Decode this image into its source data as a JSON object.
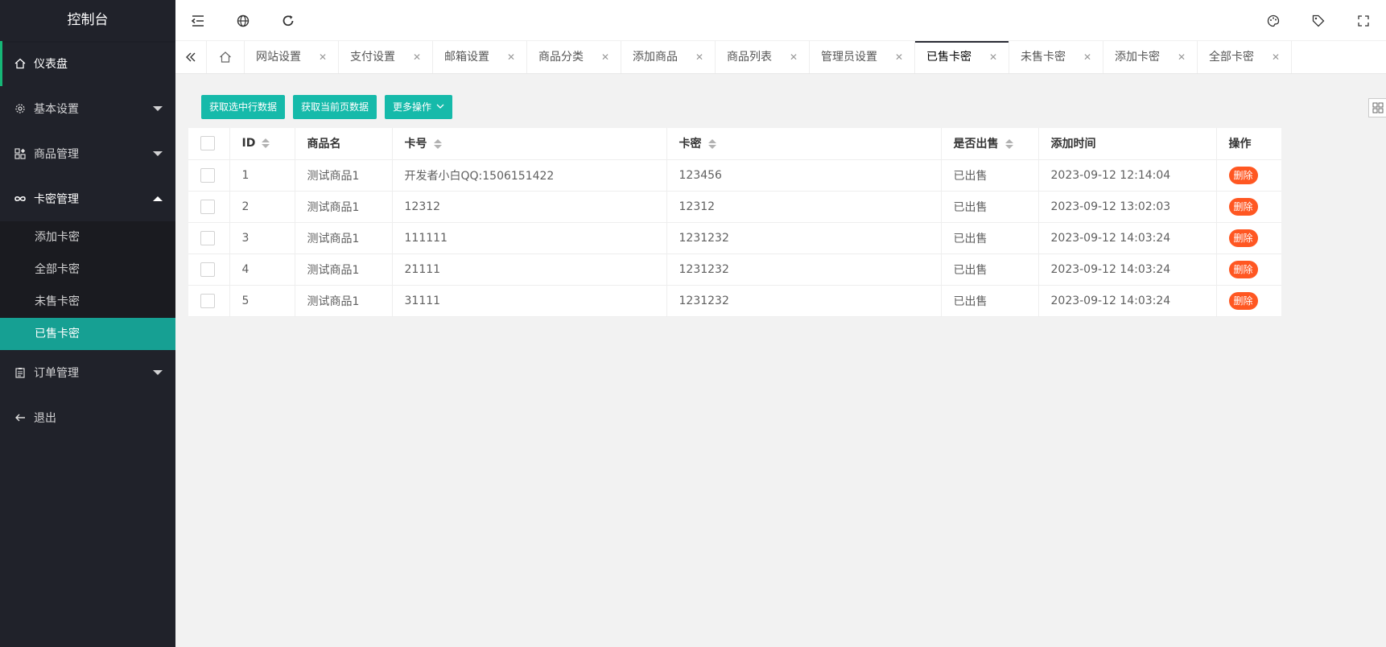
{
  "sidebar": {
    "title": "控制台",
    "items": [
      {
        "label": "仪表盘",
        "icon": "home-icon"
      },
      {
        "label": "基本设置",
        "icon": "gear-icon"
      },
      {
        "label": "商品管理",
        "icon": "apps-icon"
      },
      {
        "label": "卡密管理",
        "icon": "infinity-icon"
      },
      {
        "label": "订单管理",
        "icon": "clipboard-icon"
      },
      {
        "label": "退出",
        "icon": "arrow-left-icon"
      }
    ],
    "submenu": [
      {
        "label": "添加卡密"
      },
      {
        "label": "全部卡密"
      },
      {
        "label": "未售卡密"
      },
      {
        "label": "已售卡密"
      }
    ]
  },
  "header": {
    "left_icons": [
      "menu-fold-icon",
      "globe-icon",
      "refresh-icon"
    ],
    "right_icons": [
      "palette-icon",
      "tag-icon",
      "fullscreen-icon"
    ]
  },
  "tabs": [
    {
      "label": "网站设置"
    },
    {
      "label": "支付设置"
    },
    {
      "label": "邮箱设置"
    },
    {
      "label": "商品分类"
    },
    {
      "label": "添加商品"
    },
    {
      "label": "商品列表"
    },
    {
      "label": "管理员设置"
    },
    {
      "label": "已售卡密"
    },
    {
      "label": "未售卡密"
    },
    {
      "label": "添加卡密"
    },
    {
      "label": "全部卡密"
    }
  ],
  "toolbar": {
    "btn_selected": "获取选中行数据",
    "btn_current_page": "获取当前页数据",
    "btn_more": "更多操作"
  },
  "table": {
    "headers": {
      "id": "ID",
      "product": "商品名",
      "card_no": "卡号",
      "card_secret": "卡密",
      "sold": "是否出售",
      "added": "添加时间",
      "action": "操作"
    },
    "rows": [
      {
        "id": "1",
        "product": "测试商品1",
        "card_no": "开发者小白QQ:1506151422",
        "card_secret": "123456",
        "sold": "已出售",
        "added": "2023-09-12 12:14:04",
        "action": "删除"
      },
      {
        "id": "2",
        "product": "测试商品1",
        "card_no": "12312",
        "card_secret": "12312",
        "sold": "已出售",
        "added": "2023-09-12 13:02:03",
        "action": "删除"
      },
      {
        "id": "3",
        "product": "测试商品1",
        "card_no": "111111",
        "card_secret": "1231232",
        "sold": "已出售",
        "added": "2023-09-12 14:03:24",
        "action": "删除"
      },
      {
        "id": "4",
        "product": "测试商品1",
        "card_no": "21111",
        "card_secret": "1231232",
        "sold": "已出售",
        "added": "2023-09-12 14:03:24",
        "action": "删除"
      },
      {
        "id": "5",
        "product": "测试商品1",
        "card_no": "31111",
        "card_secret": "1231232",
        "sold": "已出售",
        "added": "2023-09-12 14:03:24",
        "action": "删除"
      }
    ]
  },
  "colors": {
    "sidebar_bg": "#20222a",
    "accent": "#16baaa",
    "active_sub": "#16a093",
    "delete": "#ff5722"
  }
}
